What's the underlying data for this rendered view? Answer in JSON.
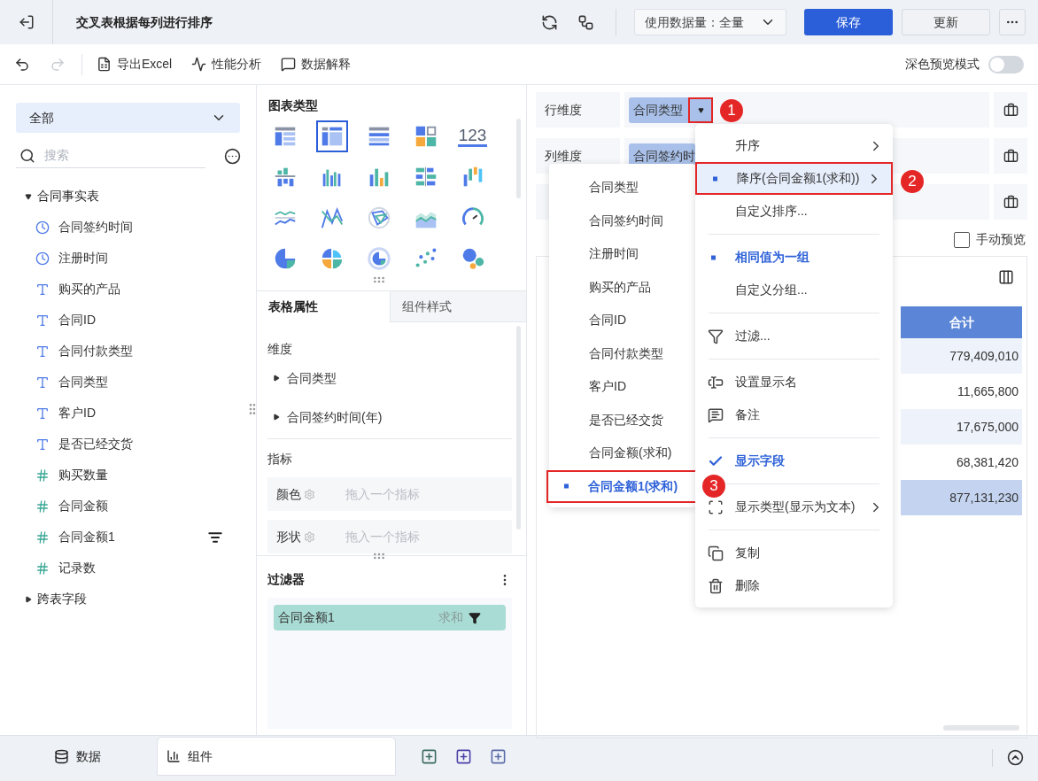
{
  "header": {
    "title": "交叉表根据每列进行排序",
    "data_volume": "使用数据量：全量",
    "buttons": [
      {
        "label": "保存",
        "kind": "primary"
      },
      {
        "label": "更新",
        "kind": "default"
      }
    ]
  },
  "toolbar": {
    "redo_disabled": true,
    "items": [
      {
        "label": "导出Excel",
        "kind": "excel"
      },
      {
        "label": "性能分析",
        "kind": "performance"
      },
      {
        "label": "数据解释",
        "kind": "explain"
      }
    ],
    "dark_preview": {
      "label": "深色预览模式",
      "on": false
    }
  },
  "fields": {
    "scope": "全部",
    "search_placeholder": "搜索",
    "tree": [
      {
        "label": "合同事实表",
        "expanded": true,
        "children": [
          {
            "label": "合同签约时间",
            "kind": "date",
            "filtered": false
          },
          {
            "label": "注册时间",
            "kind": "date",
            "filtered": false
          },
          {
            "label": "购买的产品",
            "kind": "text",
            "filtered": false
          },
          {
            "label": "合同ID",
            "kind": "text",
            "filtered": false
          },
          {
            "label": "合同付款类型",
            "kind": "text",
            "filtered": false
          },
          {
            "label": "合同类型",
            "kind": "text",
            "filtered": false
          },
          {
            "label": "客户ID",
            "kind": "text",
            "filtered": false
          },
          {
            "label": "是否已经交货",
            "kind": "text",
            "filtered": false
          },
          {
            "label": "购买数量",
            "kind": "number",
            "filtered": false
          },
          {
            "label": "合同金额",
            "kind": "number",
            "filtered": false
          },
          {
            "label": "合同金额1",
            "kind": "number",
            "filtered": true
          },
          {
            "label": "记录数",
            "kind": "count",
            "filtered": false
          }
        ]
      },
      {
        "label": "跨表字段",
        "expanded": false
      }
    ]
  },
  "chart_panel": {
    "title": "图表类型",
    "chart_types": [
      {
        "kind": "table",
        "selected": false
      },
      {
        "kind": "crosstab",
        "selected": true
      },
      {
        "kind": "detail",
        "selected": false
      },
      {
        "kind": "card",
        "selected": false
      },
      {
        "kind": "kpi",
        "label": "123",
        "selected": false
      },
      {
        "kind": "stacked_bar",
        "selected": false
      },
      {
        "kind": "grouped_bar",
        "selected": false
      },
      {
        "kind": "column",
        "selected": false
      },
      {
        "kind": "bar",
        "selected": false
      },
      {
        "kind": "waterfall",
        "selected": false
      },
      {
        "kind": "line",
        "selected": false
      },
      {
        "kind": "cross_line",
        "selected": false
      },
      {
        "kind": "radar",
        "selected": false
      },
      {
        "kind": "area",
        "selected": false
      },
      {
        "kind": "gauge",
        "selected": false
      },
      {
        "kind": "pie",
        "selected": false
      },
      {
        "kind": "rose",
        "selected": false
      },
      {
        "kind": "ring",
        "selected": false
      },
      {
        "kind": "scatter",
        "selected": false
      },
      {
        "kind": "bubble",
        "selected": false
      }
    ]
  },
  "properties": {
    "tabs": [
      {
        "label": "表格属性",
        "selected": true
      },
      {
        "label": "组件样式",
        "selected": false
      }
    ],
    "dimensions": {
      "title": "维度",
      "items": [
        "合同类型",
        "合同签约时间(年)"
      ]
    },
    "measures": {
      "title": "指标",
      "slots": [
        {
          "label": "颜色",
          "placeholder": "拖入一个指标"
        },
        {
          "label": "形状",
          "placeholder": "拖入一个指标"
        }
      ]
    },
    "filters": {
      "title": "过滤器",
      "items": [
        {
          "field": "合同金额1",
          "aggregation": "求和"
        }
      ]
    }
  },
  "layout_panel": {
    "rows": [
      {
        "kind": "shelf",
        "label": "行维度",
        "chips": [
          "合同类型"
        ]
      },
      {
        "kind": "shelf",
        "label": "列维度",
        "chips": [
          "合同签约时"
        ]
      },
      {
        "kind": "shelf"
      }
    ],
    "manual_preview": {
      "label": "手动预览",
      "checked": false
    }
  },
  "table": {
    "columns": [
      "合计"
    ],
    "rows": [
      {
        "value": "779,409,010",
        "kind": "data"
      },
      {
        "value": "11,665,800",
        "kind": "data"
      },
      {
        "value": "17,675,000",
        "kind": "data"
      },
      {
        "value": "68,381,420",
        "kind": "data"
      },
      {
        "value": "877,131,230",
        "kind": "total"
      }
    ]
  },
  "context_menu": {
    "items": [
      {
        "kind": "item",
        "label": "升序",
        "submenu": true,
        "selected": false,
        "highlighted": false
      },
      {
        "kind": "item",
        "label": "降序(合同金额1(求和))",
        "submenu": true,
        "selected": true,
        "highlighted": true
      },
      {
        "kind": "item",
        "label": "自定义排序...",
        "submenu": false,
        "selected": false,
        "highlighted": false
      },
      {
        "kind": "divider"
      },
      {
        "kind": "item",
        "label": "相同值为一组",
        "submenu": false,
        "selected": true,
        "highlighted": false
      },
      {
        "kind": "item",
        "label": "自定义分组...",
        "submenu": false,
        "selected": false,
        "highlighted": false
      },
      {
        "kind": "divider"
      },
      {
        "kind": "filter",
        "label": "过滤...",
        "submenu": false,
        "selected": false,
        "highlighted": false
      },
      {
        "kind": "divider"
      },
      {
        "kind": "rename",
        "label": "设置显示名",
        "submenu": false,
        "selected": false,
        "highlighted": false
      },
      {
        "kind": "note",
        "label": "备注",
        "submenu": false,
        "selected": false,
        "highlighted": false
      },
      {
        "kind": "divider"
      },
      {
        "kind": "check",
        "label": "显示字段",
        "submenu": false,
        "selected": true,
        "highlighted": false
      },
      {
        "kind": "divider"
      },
      {
        "kind": "display",
        "label": "显示类型(显示为文本)",
        "submenu": true,
        "selected": false,
        "highlighted": false
      },
      {
        "kind": "divider"
      },
      {
        "kind": "copy",
        "label": "复制",
        "submenu": false,
        "selected": false,
        "highlighted": false
      },
      {
        "kind": "delete",
        "label": "删除",
        "submenu": false,
        "selected": false,
        "highlighted": false
      }
    ]
  },
  "sort_submenu": {
    "items": [
      {
        "label": "合同类型",
        "selected": false
      },
      {
        "label": "合同签约时间",
        "selected": false
      },
      {
        "label": "注册时间",
        "selected": false
      },
      {
        "label": "购买的产品",
        "selected": false
      },
      {
        "label": "合同ID",
        "selected": false
      },
      {
        "label": "合同付款类型",
        "selected": false
      },
      {
        "label": "客户ID",
        "selected": false
      },
      {
        "label": "是否已经交货",
        "selected": false
      },
      {
        "label": "合同金额(求和)",
        "selected": false
      },
      {
        "label": "合同金额1(求和)",
        "selected": true
      }
    ]
  },
  "annotations": [
    {
      "number": "1"
    },
    {
      "number": "2"
    },
    {
      "number": "3"
    }
  ],
  "bottom_tabs": [
    {
      "label": "数据",
      "kind": "data",
      "selected": false
    },
    {
      "label": "组件",
      "kind": "component",
      "selected": true
    }
  ]
}
